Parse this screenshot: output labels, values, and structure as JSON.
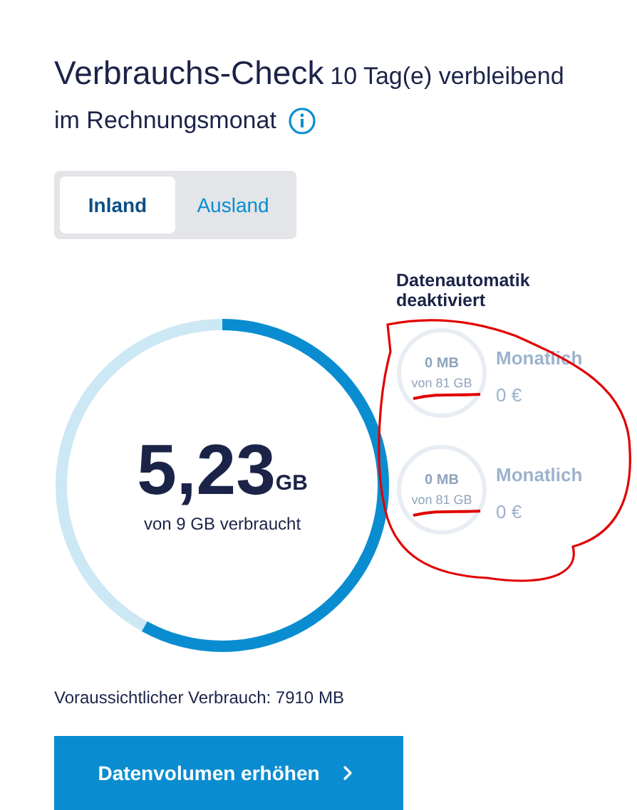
{
  "title": "Verbrauchs-Check",
  "remaining": "10 Tag(e) verbleibend",
  "subtitle": "im Rechnungsmonat",
  "tabs": [
    {
      "label": "Inland",
      "selected": true
    },
    {
      "label": "Ausland",
      "selected": false
    }
  ],
  "usage": {
    "amount": "5,23",
    "unit": "GB",
    "caption": "von 9 GB verbraucht",
    "level": 0.58
  },
  "automatic": {
    "heading": "Datenautomatik deaktiviert",
    "packs": [
      {
        "amount": "0 MB",
        "of": "von 81 GB",
        "period": "Monatlich",
        "price": "0 €"
      },
      {
        "amount": "0 MB",
        "of": "von 81 GB",
        "period": "Monatlich",
        "price": "0 €"
      }
    ]
  },
  "forecast": "Voraussichtlicher Verbrauch: 7910 MB",
  "button": "Datenvolumen erhöhen"
}
